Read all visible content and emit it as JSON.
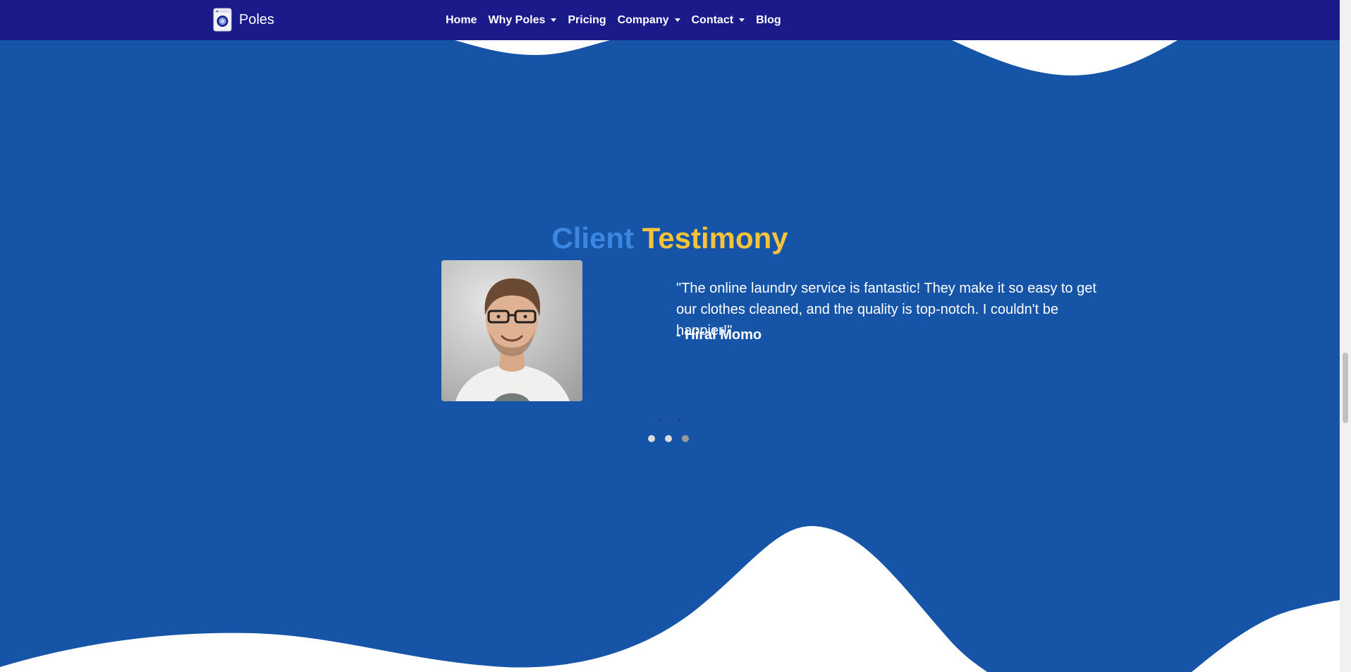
{
  "brand": {
    "name": "Poles",
    "icon": "washing-machine-icon"
  },
  "nav": {
    "items": [
      {
        "label": "Home",
        "dropdown": false
      },
      {
        "label": "Why Poles",
        "dropdown": true
      },
      {
        "label": "Pricing",
        "dropdown": false
      },
      {
        "label": "Company",
        "dropdown": true
      },
      {
        "label": "Contact",
        "dropdown": true
      },
      {
        "label": "Blog",
        "dropdown": false
      }
    ]
  },
  "testimony": {
    "heading_word_1": "Client",
    "heading_word_2": "Testimony",
    "quote": "\"The online laundry service is fantastic! They make it so easy to get our clothes cleaned, and the quality is top-notch. I couldn't be happier!\"",
    "author": "- Hirai Momo",
    "prev_arrow": "‹",
    "next_arrow": "›",
    "slide_count": 3,
    "active_slide": 1
  },
  "colors": {
    "navbar": "#1a1a8a",
    "section_bg": "#1554a6",
    "heading_client": "#3a86e0",
    "heading_testimony": "#f5c23b",
    "text": "#ffffff"
  }
}
